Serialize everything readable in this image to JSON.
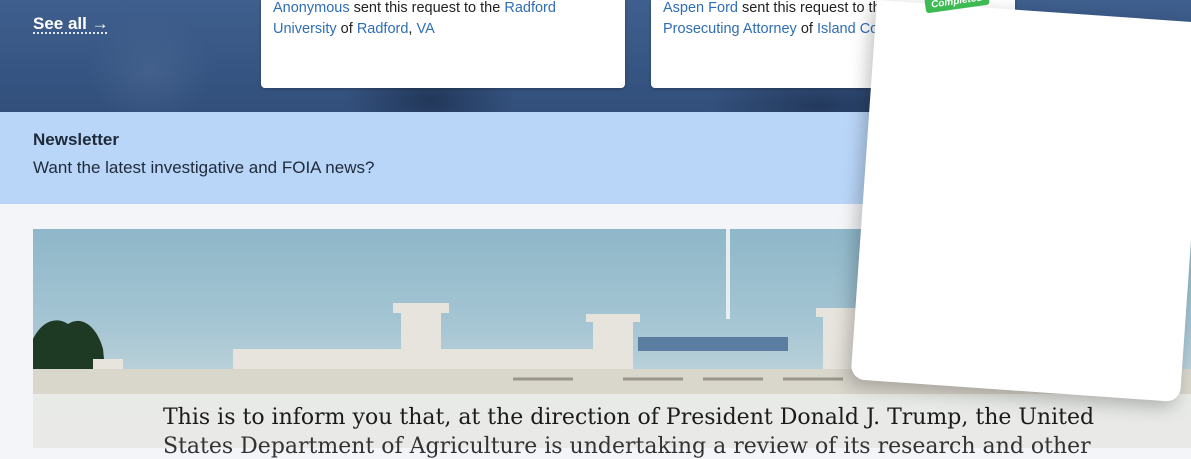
{
  "hero": {
    "see_all": "See all →"
  },
  "cards": [
    {
      "requester": "Anonymous",
      "middle": " sent this request to the ",
      "agency_part1": "Radford",
      "agency_part2": "University",
      "of_text": " of ",
      "place": "Radford",
      "comma": ", ",
      "state": "VA"
    },
    {
      "requester": "Aspen Ford",
      "middle": " sent this request to the ",
      "agency_part1": "",
      "agency_part2": "Prosecuting Attorney",
      "of_text": " of ",
      "place": "Island Cour",
      "comma": "",
      "state": ""
    }
  ],
  "newsletter": {
    "title": "Newsletter",
    "subtitle": "Want the latest investigative and FOIA news?"
  },
  "document": {
    "line1": "This is to inform you that, at the direction of President Donald J. Trump, the United",
    "line2": "States Department of Agriculture is undertaking a review of its research and other"
  },
  "overlay": {
    "badge": "Completed"
  },
  "colors": {
    "hero": "#3a5a88",
    "newsletter": "#b9d5f8",
    "link": "#2f6eb5",
    "badge": "#3dbb52"
  }
}
